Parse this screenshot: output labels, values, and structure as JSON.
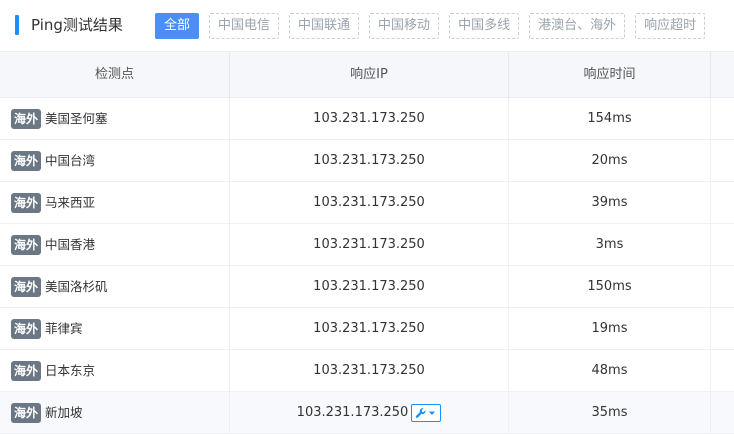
{
  "header": {
    "title": "Ping测试结果",
    "tabs": [
      {
        "label": "全部",
        "active": true
      },
      {
        "label": "中国电信",
        "active": false
      },
      {
        "label": "中国联通",
        "active": false
      },
      {
        "label": "中国移动",
        "active": false
      },
      {
        "label": "中国多线",
        "active": false
      },
      {
        "label": "港澳台、海外",
        "active": false
      },
      {
        "label": "响应超时",
        "active": false
      }
    ]
  },
  "table": {
    "columns": [
      "检测点",
      "响应IP",
      "响应时间",
      ""
    ],
    "rows": [
      {
        "badge": "海外",
        "location": "美国圣何塞",
        "ip": "103.231.173.250",
        "time": "154ms"
      },
      {
        "badge": "海外",
        "location": "中国台湾",
        "ip": "103.231.173.250",
        "time": "20ms"
      },
      {
        "badge": "海外",
        "location": "马来西亚",
        "ip": "103.231.173.250",
        "time": "39ms"
      },
      {
        "badge": "海外",
        "location": "中国香港",
        "ip": "103.231.173.250",
        "time": "3ms"
      },
      {
        "badge": "海外",
        "location": "美国洛杉矶",
        "ip": "103.231.173.250",
        "time": "150ms"
      },
      {
        "badge": "海外",
        "location": "菲律宾",
        "ip": "103.231.173.250",
        "time": "19ms"
      },
      {
        "badge": "海外",
        "location": "日本东京",
        "ip": "103.231.173.250",
        "time": "48ms"
      },
      {
        "badge": "海外",
        "location": "新加坡",
        "ip": "103.231.173.250",
        "time": "35ms",
        "tool_icon": "wrench-dropdown-icon"
      }
    ]
  },
  "colors": {
    "accent": "#1890ff",
    "active_tab": "#4a8ff7",
    "badge": "#6c7785"
  }
}
